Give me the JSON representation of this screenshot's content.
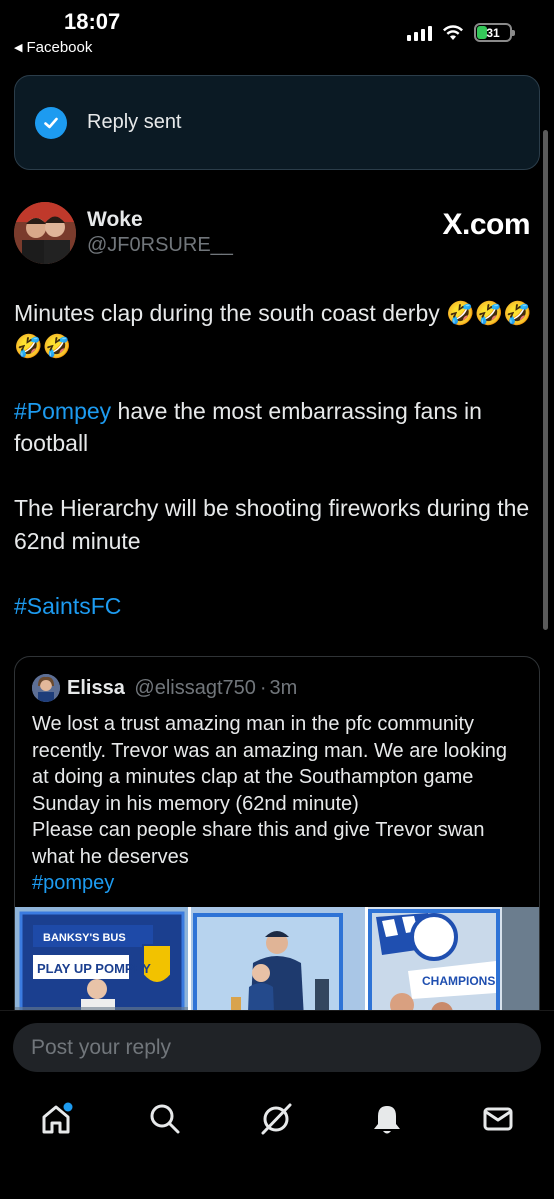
{
  "status_bar": {
    "time": "18:07",
    "back_app": "Facebook",
    "battery": "31"
  },
  "toast": {
    "message": "Reply sent",
    "icon": "checkmark-icon"
  },
  "tweet": {
    "author_name": "Woke",
    "author_handle": "@JF0RSURE__",
    "source": "X.com",
    "paragraphs": [
      {
        "text": "Minutes clap during the south coast derby 🤣🤣🤣🤣🤣"
      },
      {
        "tag": "#Pompey",
        "text": " have the most embarrassing fans in football"
      },
      {
        "text": "The Hierarchy will be shooting fireworks during the 62nd minute"
      },
      {
        "tag": "#SaintsFC"
      }
    ]
  },
  "quoted_tweet": {
    "name": "Elissa",
    "handle": "@elissagt750",
    "separator": "·",
    "time": "3m",
    "body": "We lost a trust amazing man in the pfc community recently. Trevor was an amazing man. We are looking at doing a minutes clap at the Southampton game Sunday in his memory (62nd minute)\nPlease can people share this and give Trevor swan what he deserves",
    "tag": "#pompey",
    "image_texts": [
      "BANKSY'S BUS",
      "PLAY UP POMPEY",
      "CHAMPIONS"
    ]
  },
  "reply": {
    "placeholder": "Post your reply"
  },
  "nav": [
    "home-icon",
    "search-icon",
    "grok-icon",
    "notifications-icon",
    "messages-icon"
  ],
  "colors": {
    "accent": "#1d9bf0",
    "background": "#000000",
    "muted": "#71767b",
    "text": "#e7e9ea"
  }
}
